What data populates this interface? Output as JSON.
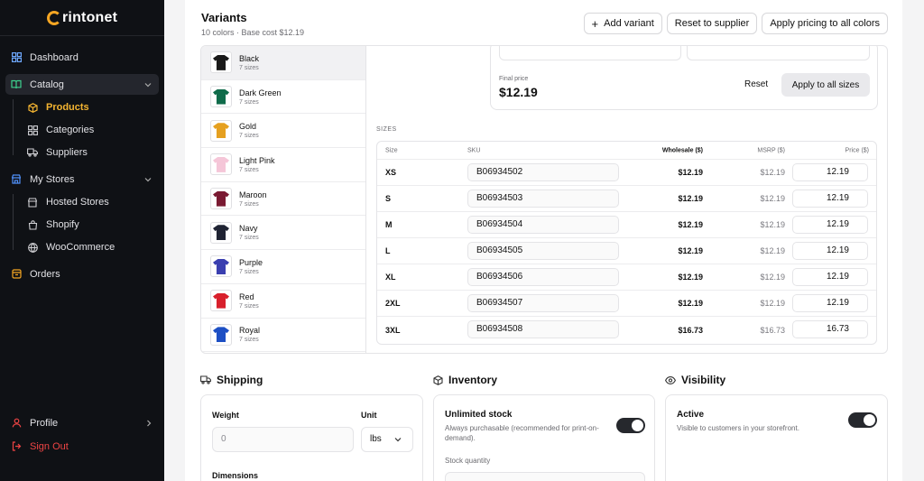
{
  "brand": {
    "name": "rintonet"
  },
  "sidebar": {
    "items": [
      {
        "label": "Dashboard",
        "icon": "grid-icon"
      },
      {
        "label": "Catalog",
        "icon": "book-icon"
      },
      {
        "label": "Products",
        "icon": "box-icon"
      },
      {
        "label": "Categories",
        "icon": "grid-icon"
      },
      {
        "label": "Suppliers",
        "icon": "truck-icon"
      },
      {
        "label": "My Stores",
        "icon": "store-icon"
      },
      {
        "label": "Hosted Stores",
        "icon": "store-icon"
      },
      {
        "label": "Shopify",
        "icon": "bag-icon"
      },
      {
        "label": "WooCommerce",
        "icon": "globe-icon"
      },
      {
        "label": "Orders",
        "icon": "package-icon"
      }
    ],
    "bottom": [
      {
        "label": "Profile",
        "icon": "user-icon"
      },
      {
        "label": "Sign Out",
        "icon": "logout-icon"
      }
    ]
  },
  "variants": {
    "title": "Variants",
    "subtitle": "10 colors · Base cost $12.19",
    "add_label": "Add variant",
    "reset_supplier_label": "Reset to supplier",
    "apply_all_colors_label": "Apply pricing to all colors",
    "colors": [
      {
        "name": "Black",
        "sizes": "7 sizes",
        "hex": "#1a1a1a"
      },
      {
        "name": "Dark Green",
        "sizes": "7 sizes",
        "hex": "#0f6b4a"
      },
      {
        "name": "Gold",
        "sizes": "7 sizes",
        "hex": "#e5a020"
      },
      {
        "name": "Light Pink",
        "sizes": "7 sizes",
        "hex": "#f5c6d8"
      },
      {
        "name": "Maroon",
        "sizes": "7 sizes",
        "hex": "#7a1a32"
      },
      {
        "name": "Navy",
        "sizes": "7 sizes",
        "hex": "#1f2333"
      },
      {
        "name": "Purple",
        "sizes": "7 sizes",
        "hex": "#3a3fb0"
      },
      {
        "name": "Red",
        "sizes": "7 sizes",
        "hex": "#d8202c"
      },
      {
        "name": "Royal",
        "sizes": "7 sizes",
        "hex": "#1d4fc4"
      }
    ],
    "price_card": {
      "final_label": "Final price",
      "final_value": "$12.19",
      "reset_label": "Reset",
      "apply_label": "Apply to all sizes"
    },
    "sizes_label": "SIZES",
    "table": {
      "headers": {
        "size": "Size",
        "sku": "SKU",
        "wholesale": "Wholesale ($)",
        "msrp": "MSRP ($)",
        "price": "Price ($)"
      },
      "rows": [
        {
          "size": "XS",
          "sku": "B06934502",
          "wholesale": "$12.19",
          "msrp": "$12.19",
          "price": "12.19"
        },
        {
          "size": "S",
          "sku": "B06934503",
          "wholesale": "$12.19",
          "msrp": "$12.19",
          "price": "12.19"
        },
        {
          "size": "M",
          "sku": "B06934504",
          "wholesale": "$12.19",
          "msrp": "$12.19",
          "price": "12.19"
        },
        {
          "size": "L",
          "sku": "B06934505",
          "wholesale": "$12.19",
          "msrp": "$12.19",
          "price": "12.19"
        },
        {
          "size": "XL",
          "sku": "B06934506",
          "wholesale": "$12.19",
          "msrp": "$12.19",
          "price": "12.19"
        },
        {
          "size": "2XL",
          "sku": "B06934507",
          "wholesale": "$12.19",
          "msrp": "$12.19",
          "price": "12.19"
        },
        {
          "size": "3XL",
          "sku": "B06934508",
          "wholesale": "$16.73",
          "msrp": "$16.73",
          "price": "16.73"
        }
      ]
    }
  },
  "shipping": {
    "title": "Shipping",
    "weight_label": "Weight",
    "weight_value": "0",
    "unit_label": "Unit",
    "unit_value": "lbs",
    "dimensions_label": "Dimensions"
  },
  "inventory": {
    "title": "Inventory",
    "stock_label": "Unlimited stock",
    "stock_desc": "Always purchasable (recommended for print-on-demand).",
    "quantity_label": "Stock quantity"
  },
  "visibility": {
    "title": "Visibility",
    "active_label": "Active",
    "active_desc": "Visible to customers in your storefront."
  },
  "colors": {
    "accent": "#f5b531",
    "danger": "#ef4444",
    "sidebar_bg": "#0f1115"
  }
}
